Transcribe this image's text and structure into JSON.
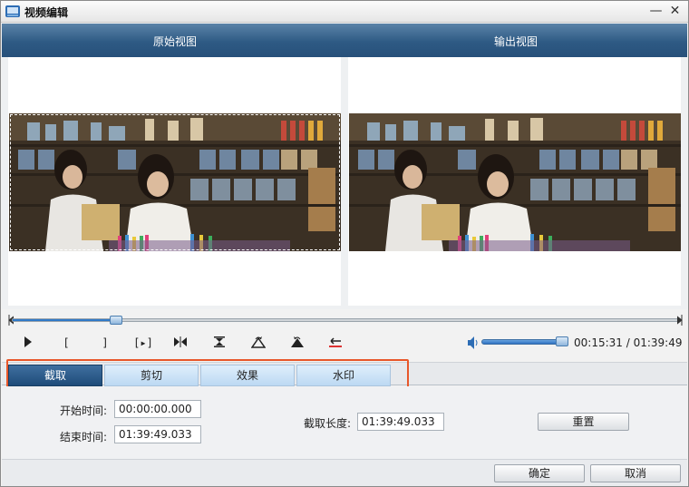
{
  "window": {
    "title": "视频编辑"
  },
  "views": {
    "original_label": "原始视图",
    "output_label": "输出视图"
  },
  "playback": {
    "controls": [
      {
        "name": "play",
        "glyph": ""
      },
      {
        "name": "mark-in",
        "glyph": "["
      },
      {
        "name": "mark-out",
        "glyph": "]"
      },
      {
        "name": "play-selection",
        "glyph": "[▸]"
      },
      {
        "name": "split",
        "glyph": ""
      },
      {
        "name": "trim",
        "glyph": ""
      },
      {
        "name": "flip",
        "glyph": ""
      },
      {
        "name": "mirror",
        "glyph": ""
      },
      {
        "name": "rotate",
        "glyph": ""
      }
    ],
    "current_time": "00:15:31",
    "total_time": "01:39:49",
    "time_display": "00:15:31 / 01:39:49",
    "progress": 0.156,
    "volume": 0.9
  },
  "tabs": [
    {
      "label": "截取",
      "active": true
    },
    {
      "label": "剪切",
      "active": false
    },
    {
      "label": "效果",
      "active": false
    },
    {
      "label": "水印",
      "active": false
    }
  ],
  "form": {
    "start_label": "开始时间:",
    "start_value": "00:00:00.000",
    "end_label": "结束时间:",
    "end_value": "01:39:49.033",
    "length_label": "截取长度:",
    "length_value": "01:39:49.033",
    "reset_label": "重置"
  },
  "footer": {
    "ok_label": "确定",
    "cancel_label": "取消"
  },
  "colors": {
    "header_blue": "#2e5a84",
    "active_tab": "#1f4c7a",
    "highlight": "#e8572a",
    "accent": "#2f79c8"
  }
}
